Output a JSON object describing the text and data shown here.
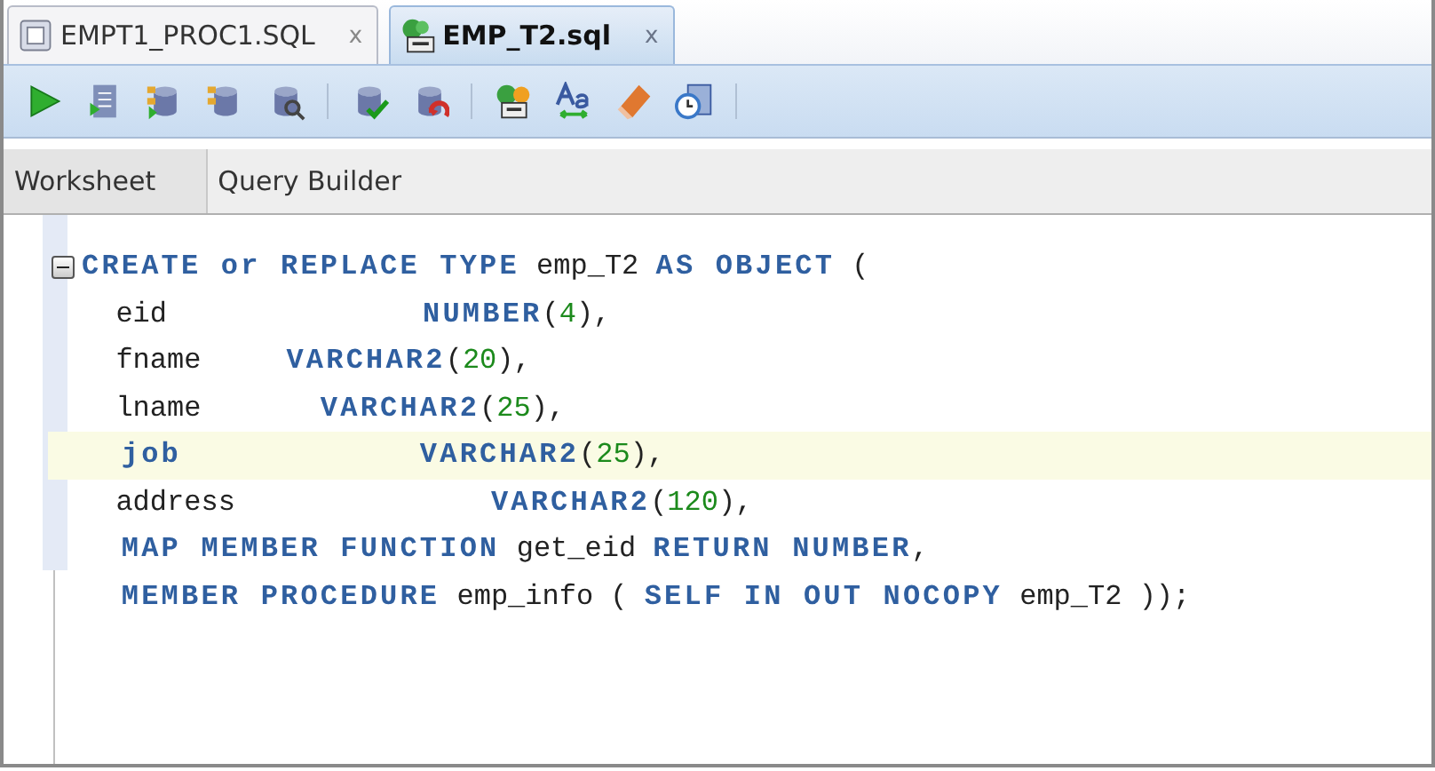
{
  "file_tabs": [
    {
      "label": "EMPT1_PROC1.SQL",
      "close": "x",
      "kind": "table",
      "selected": false
    },
    {
      "label": "EMP_T2.sql",
      "close": "x",
      "kind": "sql",
      "selected": true
    }
  ],
  "sub_tabs": [
    {
      "label": "Worksheet",
      "selected": true
    },
    {
      "label": "Query Builder",
      "selected": false
    }
  ],
  "editor": {
    "lines": [
      {
        "highlighted": false,
        "fold": true,
        "tokens": [
          {
            "kind": "kw",
            "text": "CREATE or REPLACE TYPE"
          },
          {
            "kind": "plain",
            "text": " emp_T2 "
          },
          {
            "kind": "kw",
            "text": "AS OBJECT"
          },
          {
            "kind": "plain",
            "text": " ("
          }
        ]
      },
      {
        "highlighted": false,
        "fold": false,
        "tokens": [
          {
            "kind": "plain",
            "text": "  eid               "
          },
          {
            "kind": "kw",
            "text": "NUMBER"
          },
          {
            "kind": "plain",
            "text": "("
          },
          {
            "kind": "num",
            "text": "4"
          },
          {
            "kind": "plain",
            "text": "),"
          }
        ]
      },
      {
        "highlighted": false,
        "fold": false,
        "tokens": [
          {
            "kind": "plain",
            "text": "  fname     "
          },
          {
            "kind": "kw",
            "text": "VARCHAR2"
          },
          {
            "kind": "plain",
            "text": "("
          },
          {
            "kind": "num",
            "text": "20"
          },
          {
            "kind": "plain",
            "text": "),"
          }
        ]
      },
      {
        "highlighted": false,
        "fold": false,
        "tokens": [
          {
            "kind": "plain",
            "text": "  lname       "
          },
          {
            "kind": "kw",
            "text": "VARCHAR2"
          },
          {
            "kind": "plain",
            "text": "("
          },
          {
            "kind": "num",
            "text": "25"
          },
          {
            "kind": "plain",
            "text": "),"
          }
        ]
      },
      {
        "highlighted": true,
        "fold": false,
        "tokens": [
          {
            "kind": "kw",
            "text": "  job            VARCHAR2"
          },
          {
            "kind": "plain",
            "text": "("
          },
          {
            "kind": "num",
            "text": "25"
          },
          {
            "kind": "plain",
            "text": "),"
          }
        ]
      },
      {
        "highlighted": false,
        "fold": false,
        "tokens": [
          {
            "kind": "plain",
            "text": "  address               "
          },
          {
            "kind": "kw",
            "text": "VARCHAR2"
          },
          {
            "kind": "plain",
            "text": "("
          },
          {
            "kind": "num",
            "text": "120"
          },
          {
            "kind": "plain",
            "text": "),"
          }
        ]
      },
      {
        "highlighted": false,
        "fold": false,
        "tokens": [
          {
            "kind": "kw",
            "text": "  MAP MEMBER FUNCTION"
          },
          {
            "kind": "plain",
            "text": " get_eid "
          },
          {
            "kind": "kw",
            "text": "RETURN NUMBER"
          },
          {
            "kind": "plain",
            "text": ","
          }
        ]
      },
      {
        "highlighted": false,
        "fold": false,
        "tokens": [
          {
            "kind": "kw",
            "text": "  MEMBER PROCEDURE"
          },
          {
            "kind": "plain",
            "text": " emp_info ( "
          },
          {
            "kind": "kw",
            "text": "SELF IN OUT NOCOPY"
          },
          {
            "kind": "plain",
            "text": " emp_T2 ));"
          }
        ]
      }
    ]
  }
}
